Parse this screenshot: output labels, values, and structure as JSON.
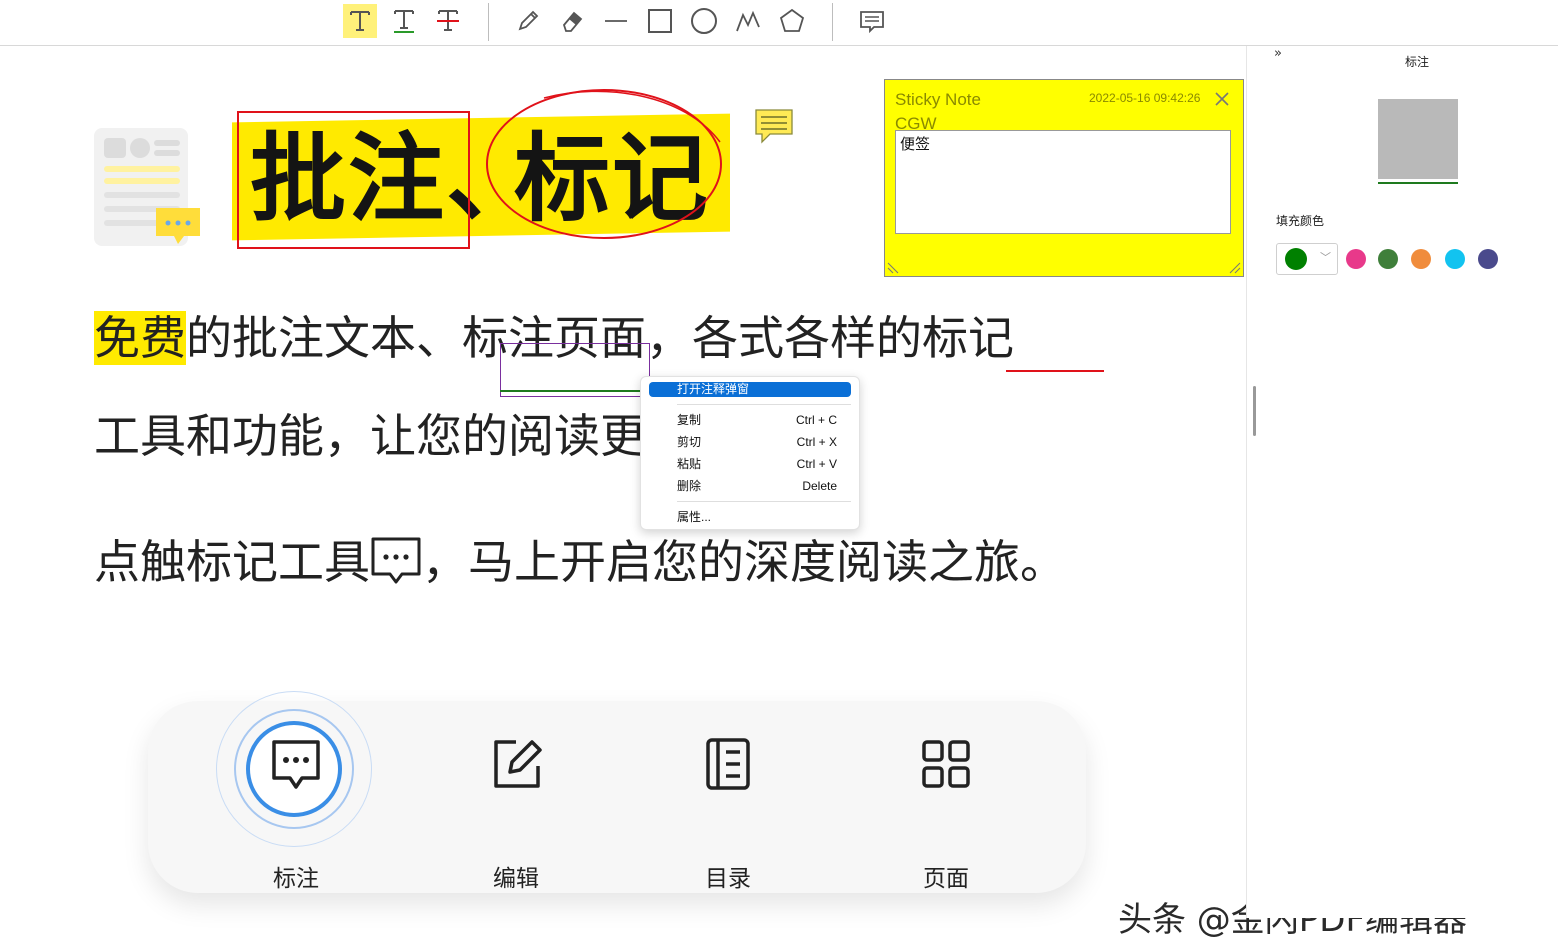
{
  "toolbar": {
    "tools": [
      "highlight-text",
      "underline-text",
      "strikethrough-text",
      "pencil",
      "eraser",
      "line",
      "rectangle",
      "ellipse",
      "polyline",
      "polygon",
      "note"
    ]
  },
  "document": {
    "title_part1": "批注、",
    "title_part2": "标记",
    "para1_line1": {
      "seg1": "免费",
      "seg2": "的批注文本、",
      "seg3": "标注页",
      "seg4": "面，各式各样的",
      "seg5": "标记"
    },
    "para1_line2": "工具和功能，让您的阅读更进一步。",
    "para2": {
      "before": "点触标记工具",
      "after": "，马上开启您的深度阅读之旅。"
    }
  },
  "sticky_note": {
    "title": "Sticky Note",
    "author": "CGW",
    "timestamp": "2022-05-16 09:42:26",
    "content": "便签"
  },
  "context_menu": {
    "items": [
      {
        "label": "打开注释弹窗",
        "shortcut": ""
      },
      {
        "label": "复制",
        "shortcut": "Ctrl + C"
      },
      {
        "label": "剪切",
        "shortcut": "Ctrl + X"
      },
      {
        "label": "粘贴",
        "shortcut": "Ctrl + V"
      },
      {
        "label": "删除",
        "shortcut": "Delete"
      },
      {
        "label": "属性...",
        "shortcut": ""
      }
    ]
  },
  "bottom_bar": {
    "items": [
      {
        "label": "标注",
        "icon": "comment-icon"
      },
      {
        "label": "编辑",
        "icon": "edit-icon"
      },
      {
        "label": "目录",
        "icon": "list-icon"
      },
      {
        "label": "页面",
        "icon": "grid-icon"
      }
    ]
  },
  "right_panel": {
    "collapse": "»",
    "title": "标注",
    "fill_color_label": "填充颜色",
    "selected_color": "#008000",
    "swatches": [
      "#e8398a",
      "#3f7f3a",
      "#f08c3c",
      "#12c3f0",
      "#4a4a8c"
    ]
  },
  "watermark": "头条 @金闪PDF编辑器",
  "colors": {
    "highlight": "#ffea00",
    "annotation_red": "#e0121a",
    "accent_blue": "#3a8ee6",
    "sticky_yellow": "#ffff00"
  }
}
